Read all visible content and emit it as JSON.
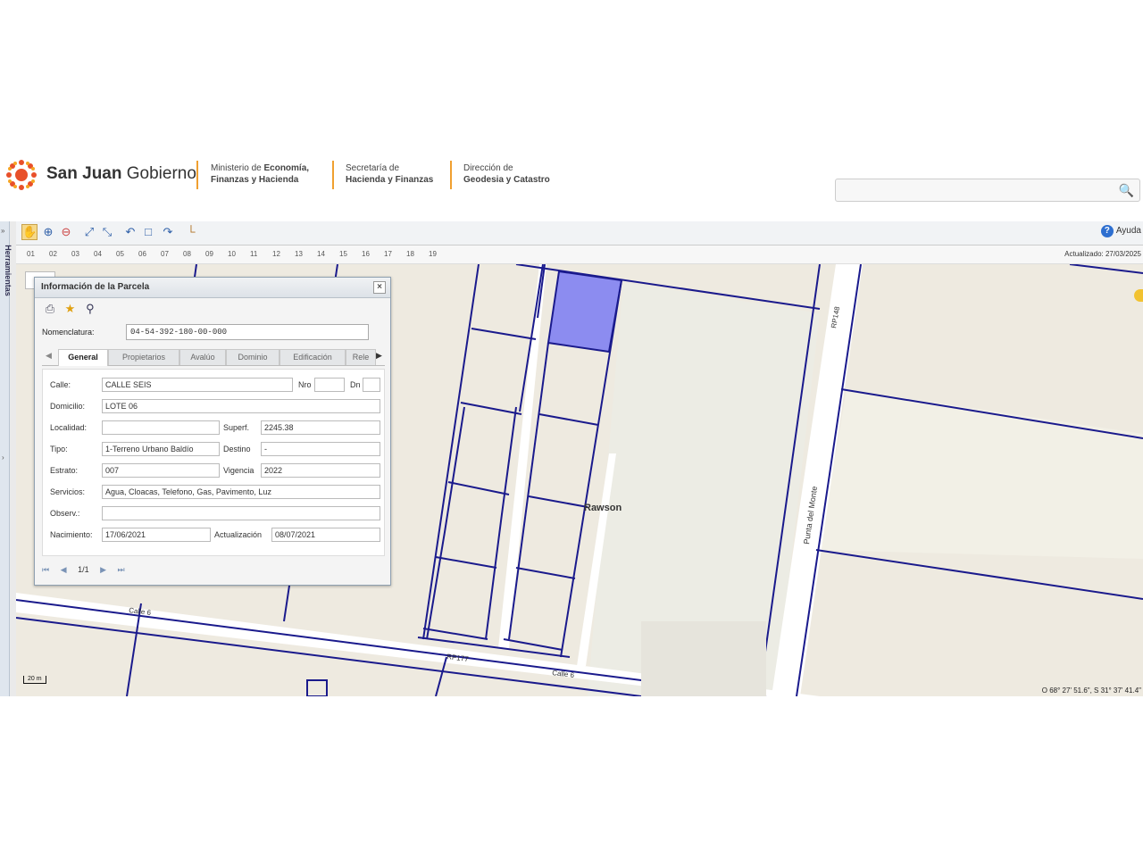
{
  "header": {
    "brand_bold": "San Juan",
    "brand_light": "Gobierno",
    "dept1_line1_light": "Ministerio de",
    "dept1_line1_bold": "Economía,",
    "dept1_line2": "Finanzas y Hacienda",
    "dept2_line1": "Secretaría de",
    "dept2_line2": "Hacienda y Finanzas",
    "dept3_line1": "Dirección de",
    "dept3_line2": "Geodesia y Catastro",
    "search_placeholder": "",
    "accent_color": "#f0a030"
  },
  "sidebar": {
    "label": "Herramientas"
  },
  "toolbar": {
    "help_label": "Ayuda",
    "tools": [
      "hand-icon",
      "zoom-in-icon",
      "zoom-out-icon",
      "zoom-extent-icon",
      "full-extent-icon",
      "undo-icon",
      "select-box-icon",
      "redo-icon",
      "measure-icon"
    ]
  },
  "ruler": {
    "ticks": [
      "01",
      "02",
      "03",
      "04",
      "05",
      "06",
      "07",
      "08",
      "09",
      "10",
      "11",
      "12",
      "13",
      "14",
      "15",
      "16",
      "17",
      "18",
      "19"
    ],
    "updated": "Actualizado: 27/03/2025"
  },
  "map": {
    "labels": {
      "rawson": "Rawson",
      "calle6_left": "Calle 6",
      "calle6_right": "Calle 6",
      "rp177": "RP177",
      "rp148": "RP148",
      "punta": "Punta del Monte"
    },
    "scale": "20 m",
    "coords": "O 68° 27' 51.6\", S 31° 37' 41.4\"",
    "line_color": "#1a1a8c",
    "highlight_color": "#8c8cf0"
  },
  "panel": {
    "title": "Información de la Parcela",
    "nomenclatura_label": "Nomenclatura:",
    "nomenclatura_value": "04-54-392-180-00-000",
    "tabs": [
      "General",
      "Propietarios",
      "Avalúo",
      "Dominio",
      "Edificación",
      "Rele"
    ],
    "fields": {
      "calle_label": "Calle:",
      "calle_value": "CALLE SEIS",
      "nro_label": "Nro",
      "nro_value": "",
      "dn_label": "Dn",
      "dn_value": "",
      "domicilio_label": "Domicilio:",
      "domicilio_value": "LOTE 06",
      "localidad_label": "Localidad:",
      "localidad_value": "",
      "superf_label": "Superf.",
      "superf_value": "2245.38",
      "tipo_label": "Tipo:",
      "tipo_value": "1-Terreno Urbano Baldío",
      "destino_label": "Destino",
      "destino_value": "-",
      "estrato_label": "Estrato:",
      "estrato_value": "007",
      "vigencia_label": "Vigencia",
      "vigencia_value": "2022",
      "servicios_label": "Servicios:",
      "servicios_value": "Agua, Cloacas, Telefono, Gas, Pavimento, Luz",
      "observ_label": "Observ.:",
      "observ_value": "",
      "nacimiento_label": "Nacimiento:",
      "nacimiento_value": "17/06/2021",
      "actualizacion_label": "Actualización",
      "actualizacion_value": "08/07/2021"
    },
    "pager": "1/1"
  }
}
